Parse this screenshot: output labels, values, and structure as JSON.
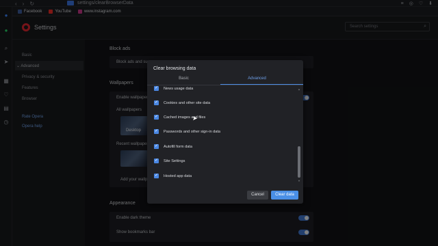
{
  "browser": {
    "url": "settings/clearBrowserData",
    "nav": [
      "‹",
      "›",
      "↻"
    ],
    "bookmarks": [
      {
        "label": "Facebook",
        "color": "#3b5998"
      },
      {
        "label": "YouTube",
        "color": "#e52d27"
      },
      {
        "label": "www.instagram.com",
        "color": "#c13584"
      }
    ]
  },
  "settings": {
    "title": "Settings",
    "search_placeholder": "Search settings",
    "nav": {
      "basic": "Basic",
      "advanced": "Advanced",
      "privacy": "Privacy & security",
      "features": "Features",
      "browser": "Browser",
      "rate": "Rate Opera",
      "help": "Opera help"
    },
    "sections": {
      "block_ads": "Block ads",
      "block_ads_row": "Block ads and sur",
      "wallpapers": "Wallpapers",
      "enable_wallpapers": "Enable wallpaper",
      "all_wallpapers": "All wallpapers",
      "desktop": "Desktop",
      "recent_wallpapers": "Recent wallpaper",
      "add_wallpaper": "Add your wallp",
      "appearance": "Appearance",
      "dark_theme": "Enable dark theme",
      "bookmarks_bar": "Show bookmarks bar"
    }
  },
  "dialog": {
    "title": "Clear browsing data",
    "tabs": {
      "basic": "Basic",
      "advanced": "Advanced"
    },
    "options": [
      {
        "label": "News usage data",
        "checked": true
      },
      {
        "label": "Cookies and other site data",
        "checked": true
      },
      {
        "label": "Cached images and files",
        "checked": true
      },
      {
        "label": "Passwords and other sign-in data",
        "checked": true
      },
      {
        "label": "Autofill form data",
        "checked": true
      },
      {
        "label": "Site Settings",
        "checked": true
      },
      {
        "label": "Hosted app data",
        "checked": true
      }
    ],
    "cancel": "Cancel",
    "clear": "Clear data"
  },
  "colors": {
    "accent": "#4a8fe6",
    "opera_red": "#d7262f"
  }
}
